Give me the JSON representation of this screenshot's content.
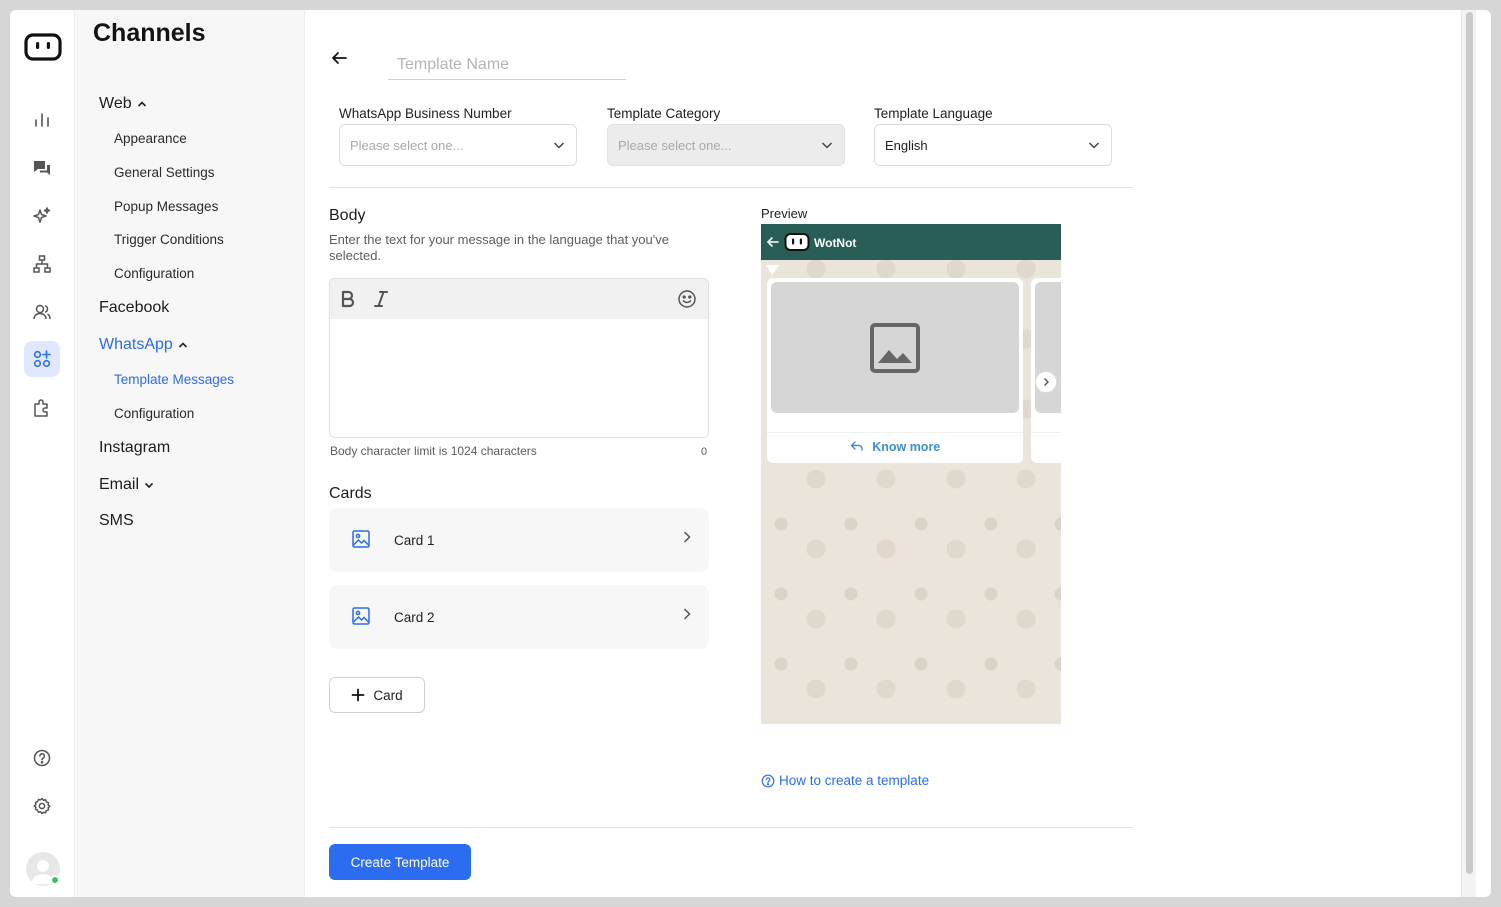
{
  "sidebar_rail": {
    "icons": [
      "app-logo-icon",
      "analytics-icon",
      "conversations-icon",
      "ai-sparkle-icon",
      "flow-builder-icon",
      "contacts-icon",
      "channels-icon",
      "integrations-icon",
      "help-icon",
      "settings-icon"
    ]
  },
  "nav": {
    "title": "Channels",
    "web": {
      "label": "Web",
      "items": [
        "Appearance",
        "General Settings",
        "Popup Messages",
        "Trigger Conditions",
        "Configuration"
      ]
    },
    "facebook": {
      "label": "Facebook"
    },
    "whatsapp": {
      "label": "WhatsApp",
      "items": [
        "Template Messages",
        "Configuration"
      ]
    },
    "instagram": {
      "label": "Instagram"
    },
    "email": {
      "label": "Email"
    },
    "sms": {
      "label": "SMS"
    }
  },
  "form": {
    "template_name_placeholder": "Template Name",
    "business_number": {
      "label": "WhatsApp Business Number",
      "placeholder": "Please select one..."
    },
    "category": {
      "label": "Template Category",
      "placeholder": "Please select one..."
    },
    "language": {
      "label": "Template Language",
      "value": "English"
    },
    "body": {
      "title": "Body",
      "help": "Enter the text for your message in the language that you've selected.",
      "char_limit": "Body character limit is 1024 characters",
      "char_count": "0"
    },
    "cards": {
      "title": "Cards",
      "items": [
        "Card 1",
        "Card 2"
      ],
      "add_label": "Card"
    },
    "create_button": "Create Template"
  },
  "preview": {
    "label": "Preview",
    "bot_name": "WotNot",
    "card_button": "Know more",
    "howto_link": "How to create a template"
  },
  "colors": {
    "accent": "#2c6cf0",
    "whatsapp_header": "#285e56",
    "link": "#2b6de8"
  }
}
